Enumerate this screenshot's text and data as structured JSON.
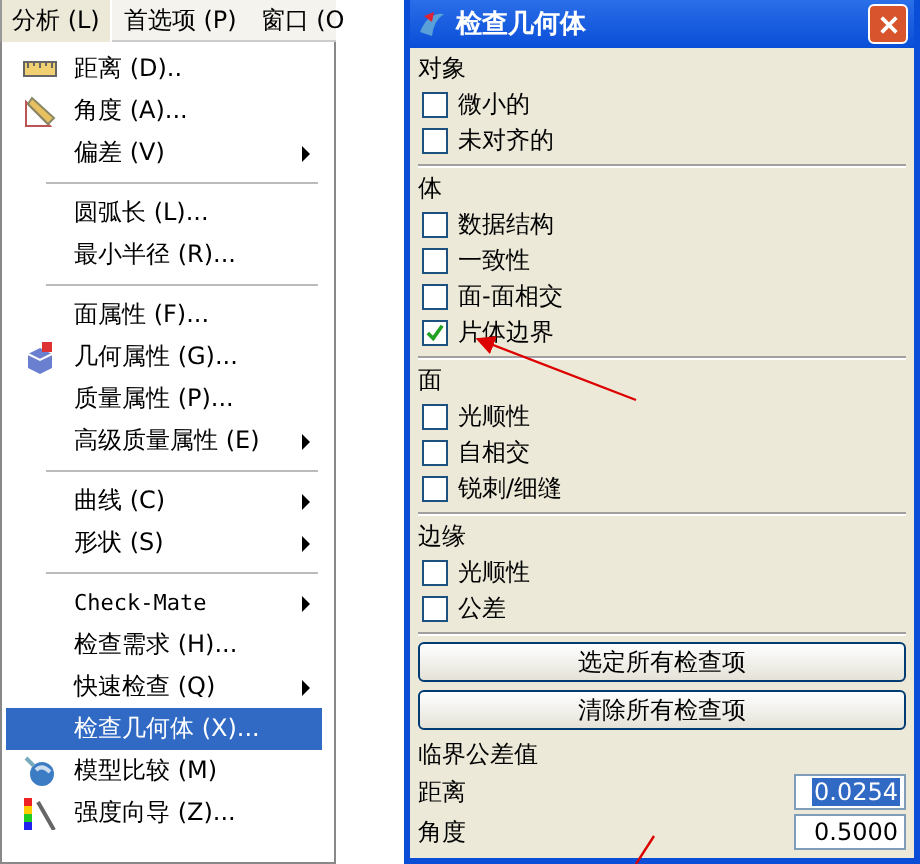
{
  "menu_bar": [
    {
      "label": "分析 (L)",
      "selected": true
    },
    {
      "label": "首选项 (P)",
      "selected": false
    },
    {
      "label": "窗口 (O",
      "selected": false
    }
  ],
  "menu": {
    "items": [
      {
        "kind": "item",
        "label": "距离 (D)..",
        "submenu": false,
        "selected": false
      },
      {
        "kind": "item",
        "label": "角度 (A)...",
        "submenu": false,
        "selected": false
      },
      {
        "kind": "item",
        "label": "偏差 (V)",
        "submenu": true,
        "selected": false
      },
      {
        "kind": "separator"
      },
      {
        "kind": "item",
        "label": "圆弧长 (L)...",
        "submenu": false,
        "selected": false
      },
      {
        "kind": "item",
        "label": "最小半径 (R)...",
        "submenu": false,
        "selected": false
      },
      {
        "kind": "separator"
      },
      {
        "kind": "item",
        "label": "面属性 (F)...",
        "submenu": false,
        "selected": false
      },
      {
        "kind": "item",
        "label": "几何属性 (G)...",
        "submenu": false,
        "selected": false
      },
      {
        "kind": "item",
        "label": "质量属性 (P)...",
        "submenu": false,
        "selected": false
      },
      {
        "kind": "item",
        "label": "高级质量属性 (E)",
        "submenu": true,
        "selected": false
      },
      {
        "kind": "separator"
      },
      {
        "kind": "item",
        "label": "曲线 (C)",
        "submenu": true,
        "selected": false
      },
      {
        "kind": "item",
        "label": "形状 (S)",
        "submenu": true,
        "selected": false
      },
      {
        "kind": "separator"
      },
      {
        "kind": "item",
        "label": "Check-Mate",
        "mono": true,
        "submenu": true,
        "selected": false
      },
      {
        "kind": "item",
        "label": "检查需求 (H)...",
        "submenu": false,
        "selected": false
      },
      {
        "kind": "item",
        "label": "快速检查 (Q)",
        "submenu": true,
        "selected": false
      },
      {
        "kind": "item",
        "label": "检查几何体 (X)...",
        "submenu": false,
        "selected": true
      },
      {
        "kind": "item",
        "label": "模型比较 (M)",
        "submenu": false,
        "selected": false
      },
      {
        "kind": "item",
        "label": "强度向导 (Z)...",
        "submenu": false,
        "selected": false
      }
    ]
  },
  "dialog": {
    "title": "检查几何体",
    "sections": [
      {
        "heading": "对象",
        "options": [
          {
            "label": "微小的",
            "checked": false
          },
          {
            "label": "未对齐的",
            "checked": false
          }
        ]
      },
      {
        "heading": "体",
        "options": [
          {
            "label": "数据结构",
            "checked": false
          },
          {
            "label": "一致性",
            "checked": false
          },
          {
            "label": "面-面相交",
            "checked": false
          },
          {
            "label": "片体边界",
            "checked": true
          }
        ]
      },
      {
        "heading": "面",
        "options": [
          {
            "label": "光顺性",
            "checked": false
          },
          {
            "label": "自相交",
            "checked": false
          },
          {
            "label": "锐刺/细缝",
            "checked": false
          }
        ]
      },
      {
        "heading": "边缘",
        "options": [
          {
            "label": "光顺性",
            "checked": false
          },
          {
            "label": "公差",
            "checked": false
          }
        ]
      }
    ],
    "buttons": [
      "选定所有检查项",
      "清除所有检查项"
    ],
    "tolerance": {
      "heading": "临界公差值",
      "fields": [
        {
          "label": "距离",
          "value": "0.0254",
          "selected": true
        },
        {
          "label": "角度",
          "value": "0.5000",
          "selected": false
        }
      ]
    }
  }
}
